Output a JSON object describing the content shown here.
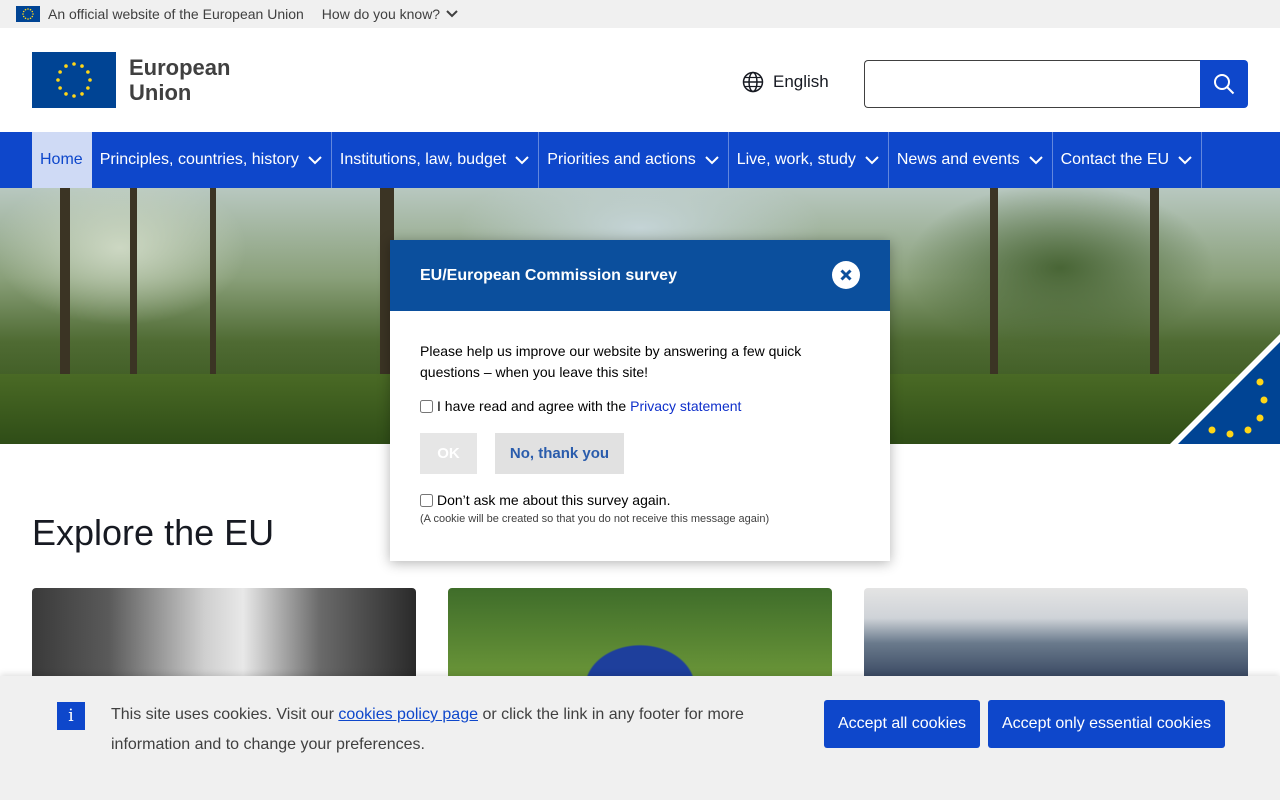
{
  "site_banner": {
    "official_text": "An official website of the European Union",
    "how_know": "How do you know?"
  },
  "header": {
    "logo_line1": "European",
    "logo_line2": "Union",
    "language": "English",
    "search_placeholder": ""
  },
  "nav": {
    "items": [
      {
        "label": "Home",
        "active": true
      },
      {
        "label": "Principles, countries, history"
      },
      {
        "label": "Institutions, law, budget"
      },
      {
        "label": "Priorities and actions"
      },
      {
        "label": "Live, work, study"
      },
      {
        "label": "News and events"
      },
      {
        "label": "Contact the EU"
      }
    ]
  },
  "main": {
    "explore_title": "Explore the EU"
  },
  "survey": {
    "title": "EU/European Commission survey",
    "message": "Please help us improve our website by answering a few quick questions – when you leave this site!",
    "agree_text": "I have read and agree with the",
    "privacy_link": "Privacy statement",
    "ok_label": "OK",
    "no_label": "No, thank you",
    "dont_ask_label": "Don’t ask me about this survey again.",
    "cookie_note": "(A cookie will be created so that you do not receive this message again)"
  },
  "cookie_banner": {
    "text_before": "This site uses cookies. Visit our",
    "policy_link": "cookies policy page",
    "text_after": "or click the link in any footer for more information and to change your preferences.",
    "accept_all": "Accept all cookies",
    "accept_essential": "Accept only essential cookies"
  },
  "colors": {
    "eu_blue": "#004494",
    "primary_blue": "#0e47cb",
    "modal_header": "#0b4f9d",
    "eu_yellow": "#ffd617"
  }
}
